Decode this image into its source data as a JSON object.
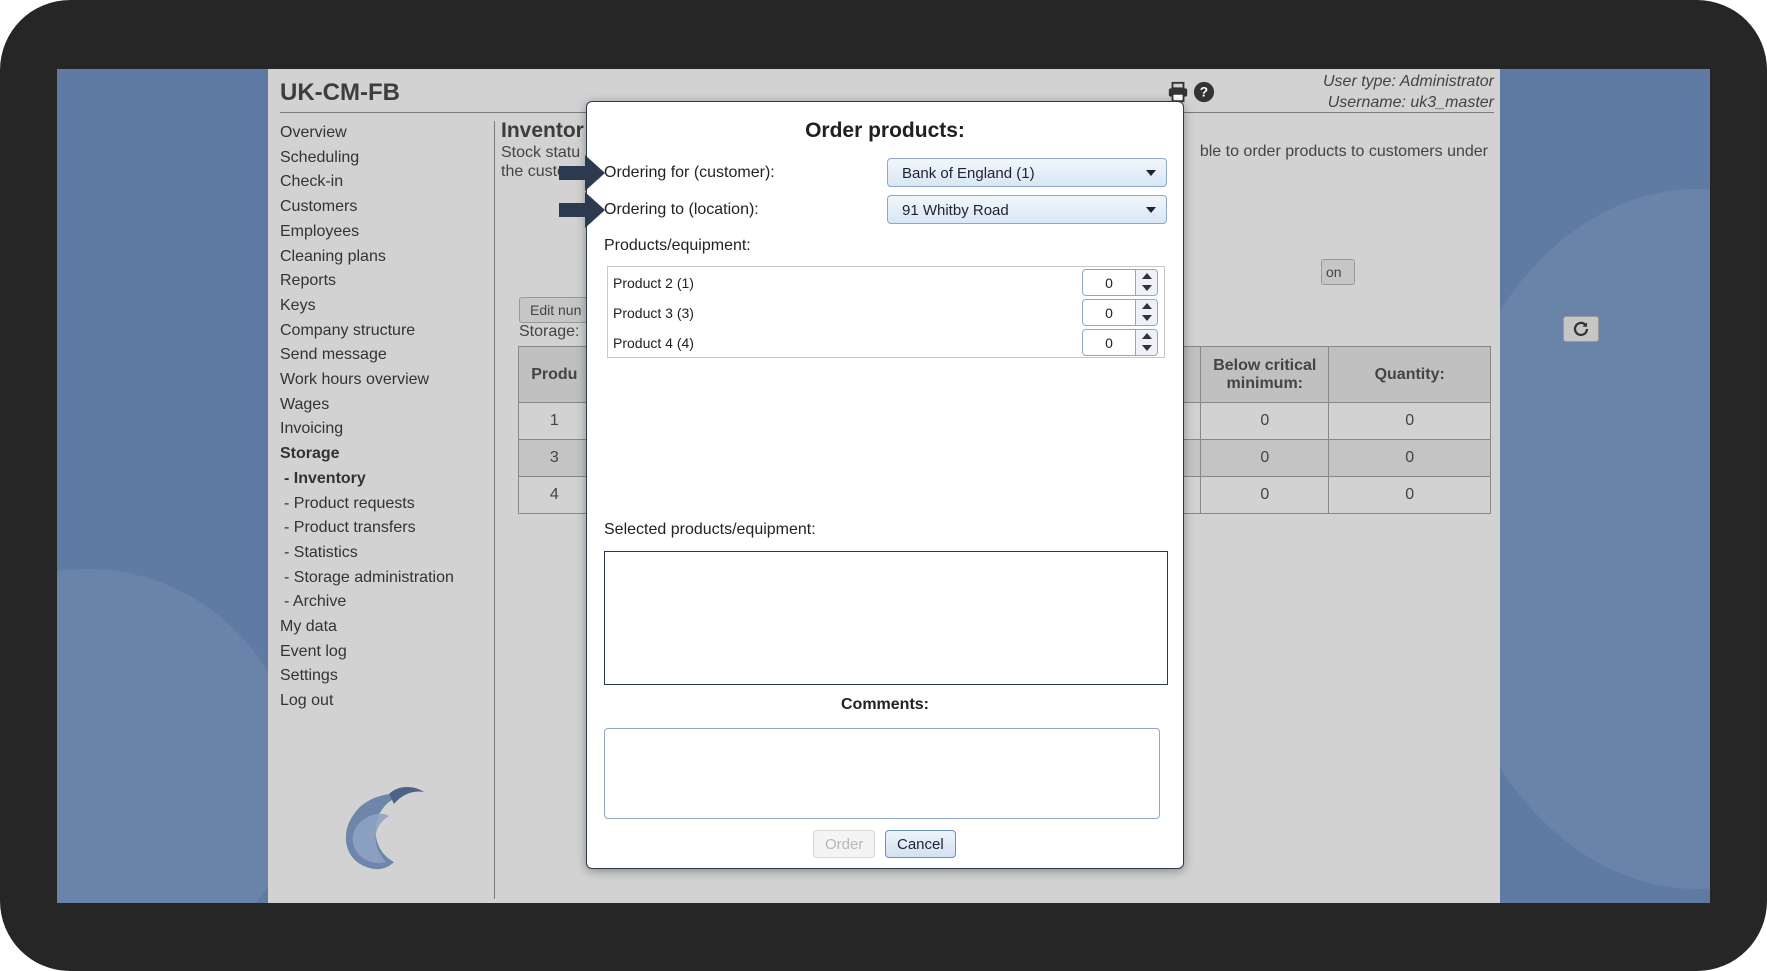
{
  "app": {
    "title": "UK-CM-FB",
    "user_type": "User type: Administrator",
    "username": "Username: uk3_master",
    "icons": [
      "print-icon",
      "help-icon"
    ]
  },
  "nav": {
    "items": [
      "Overview",
      "Scheduling",
      "Check-in",
      "Customers",
      "Employees",
      "Cleaning plans",
      "Reports",
      "Keys",
      "Company structure",
      "Send message",
      "Work hours overview",
      "Wages",
      "Invoicing"
    ],
    "storage": "Storage",
    "storage_sub": [
      "- Inventory",
      "- Product requests",
      "- Product transfers",
      "- Statistics",
      "- Storage administration",
      "- Archive"
    ],
    "bottom": [
      "My data",
      "Event log",
      "Settings",
      "Log out"
    ]
  },
  "content": {
    "title": "Inventor",
    "desc_left": "Stock statu",
    "desc_left2": "the custo",
    "desc_right": "ble to order products to customers under",
    "edit_btn": "Edit nun",
    "on_btn": "on",
    "storage_label": "Storage:",
    "table": {
      "headers": [
        "Produ",
        "Below critical minimum:",
        "Quantity:"
      ],
      "rows": [
        [
          "1",
          "0",
          "0"
        ],
        [
          "3",
          "0",
          "0"
        ],
        [
          "4",
          "0",
          "0"
        ]
      ]
    }
  },
  "dialog": {
    "title": "Order products:",
    "customer_label": "Ordering for (customer):",
    "customer_value": "Bank of England (1)",
    "location_label": "Ordering to (location):",
    "location_value": "91 Whitby Road",
    "products_label": "Products/equipment:",
    "products": [
      {
        "name": "Product 2 (1)",
        "qty": "0"
      },
      {
        "name": "Product 3 (3)",
        "qty": "0"
      },
      {
        "name": "Product 4 (4)",
        "qty": "0"
      }
    ],
    "selected_label": "Selected products/equipment:",
    "comments_label": "Comments:",
    "order_btn": "Order",
    "cancel_btn": "Cancel"
  },
  "colors": {
    "accent_arrow": "#2c3a50",
    "select_border": "#8ea8c8",
    "overlay_bg": "#d2d2d2"
  }
}
